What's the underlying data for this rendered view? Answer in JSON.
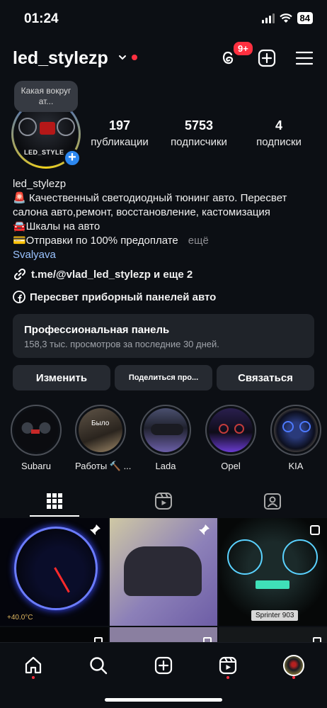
{
  "status_bar": {
    "time": "01:24",
    "battery": "84"
  },
  "header": {
    "username": "led_stylezp",
    "notifications_badge": "9+"
  },
  "profile": {
    "note": "Какая вокруг ат...",
    "avatar_text": "LED_STYLE",
    "stats": [
      {
        "value": "197",
        "label": "публикации"
      },
      {
        "value": "5753",
        "label": "подписчики"
      },
      {
        "value": "4",
        "label": "подписки"
      }
    ],
    "bio": {
      "name": "led_stylezp",
      "line1": "🚨 Качественный светодиодный тюнинг авто. Пересвет салона авто,ремонт, восстановление, кастомизация",
      "line2": "🚘Шкалы на авто",
      "line3": "💳Отправки по 100% предоплате",
      "more": "ещё",
      "location": "Svalyava"
    },
    "link": "t.me/@vlad_led_stylezp и еще 2",
    "facebook": "Пересвет приборный панелей авто"
  },
  "pro_panel": {
    "title": "Профессиональная панель",
    "subtitle": "158,3 тыс. просмотров за последние 30 дней."
  },
  "buttons": {
    "edit": "Изменить",
    "share": "Поделиться про...",
    "contact": "Связаться"
  },
  "highlights": [
    {
      "label": "Subaru"
    },
    {
      "label": "Работы 🔨 ..."
    },
    {
      "label": "Lada"
    },
    {
      "label": "Opel"
    },
    {
      "label": "KIA"
    }
  ],
  "grid": {
    "tile3_caption": "Sprinter 903",
    "highlight_tile2_text": "Было"
  },
  "colors": {
    "accent": "#2c87f0",
    "badge": "#ff3040",
    "background": "#0c0f14"
  }
}
